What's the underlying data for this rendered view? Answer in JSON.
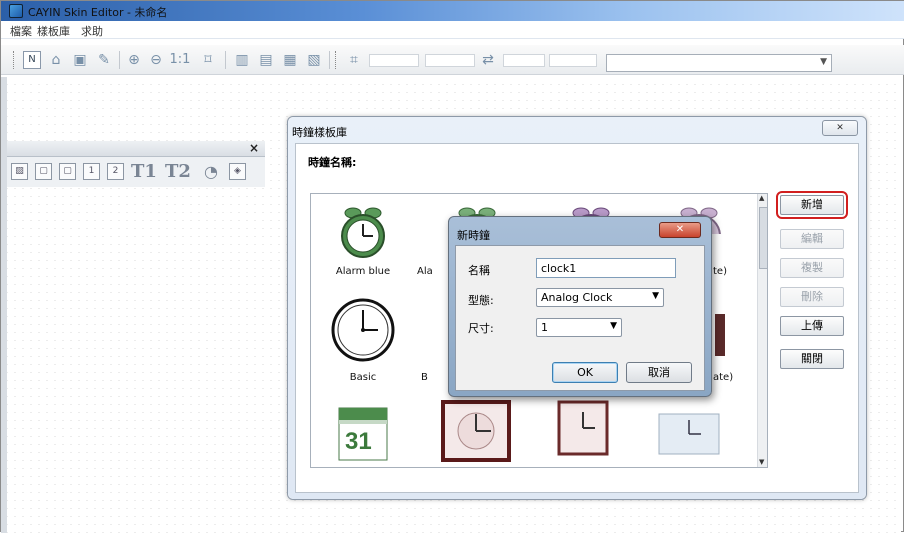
{
  "window": {
    "title": "CAYIN Skin Editor - 未命名"
  },
  "menu": [
    "檔案",
    "樣板庫",
    "求助"
  ],
  "toolbar": {
    "icons": [
      "new-icon",
      "open-icon",
      "save-icon",
      "pencil-icon",
      "zoom-in-icon",
      "zoom-out-icon",
      "actual-size-icon",
      "fit-window-icon",
      "align-top-icon",
      "align-bottom-icon",
      "align-left-icon",
      "align-right-icon",
      "size-icon",
      "position-icon"
    ],
    "zoom_text": "1:1"
  },
  "floating_panel": {
    "close": "×",
    "text_tool_1": "T1",
    "text_tool_2": "T2"
  },
  "clock_library": {
    "title": "時鐘樣板庫",
    "close": "✕",
    "name_label": "時鐘名稱:",
    "items": [
      {
        "name": "Alarm blue"
      },
      {
        "name": "Ala"
      },
      {
        "name": ""
      },
      {
        "name": "te)"
      },
      {
        "name": "Basic"
      },
      {
        "name": "B"
      },
      {
        "name": ""
      },
      {
        "name": "ate)"
      }
    ],
    "calendar_day": "31",
    "buttons": {
      "add": "新增",
      "edit": "編輯",
      "copy": "複製",
      "delete": "刪除",
      "upload": "上傳",
      "close": "關閉"
    }
  },
  "new_clock_dialog": {
    "title": "新時鐘",
    "close": "✕",
    "name_label": "名稱",
    "name_value": "clock1",
    "type_label": "型態:",
    "type_value": "Analog Clock",
    "size_label": "尺寸:",
    "size_value": "1",
    "ok": "OK",
    "cancel": "取消"
  },
  "colors": {
    "highlight": "#d11f1f",
    "titlebar": "#2b5fa8",
    "clock_green": "#3c7a3c"
  }
}
